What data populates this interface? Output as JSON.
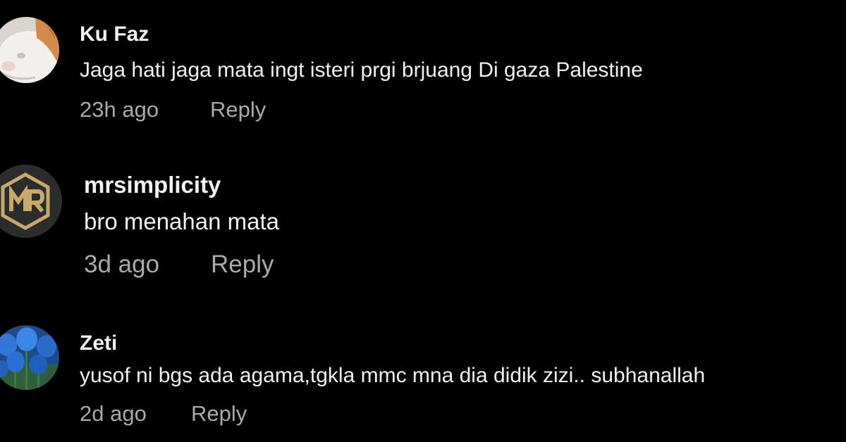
{
  "comments": [
    {
      "author": "Ku Faz",
      "text": "Jaga hati jaga mata ingt isteri prgi brjuang Di gaza Palestine",
      "time": "23h ago",
      "reply_label": "Reply",
      "avatar": "cat-photo-avatar"
    },
    {
      "author": "mrsimplicity",
      "text": "bro menahan mata",
      "time": "3d ago",
      "reply_label": "Reply",
      "avatar": "mr-logo-avatar"
    },
    {
      "author": "Zeti",
      "text": "yusof ni bgs ada agama,tgkla mmc mna dia didik zizi.. subhanallah",
      "time": "2d ago",
      "reply_label": "Reply",
      "avatar": "blue-tulips-avatar"
    }
  ],
  "colors": {
    "background": "#000000",
    "primary_text": "#f1f1f1",
    "secondary_text": "#aaaaaa",
    "logo_gold": "#c8a96a"
  }
}
